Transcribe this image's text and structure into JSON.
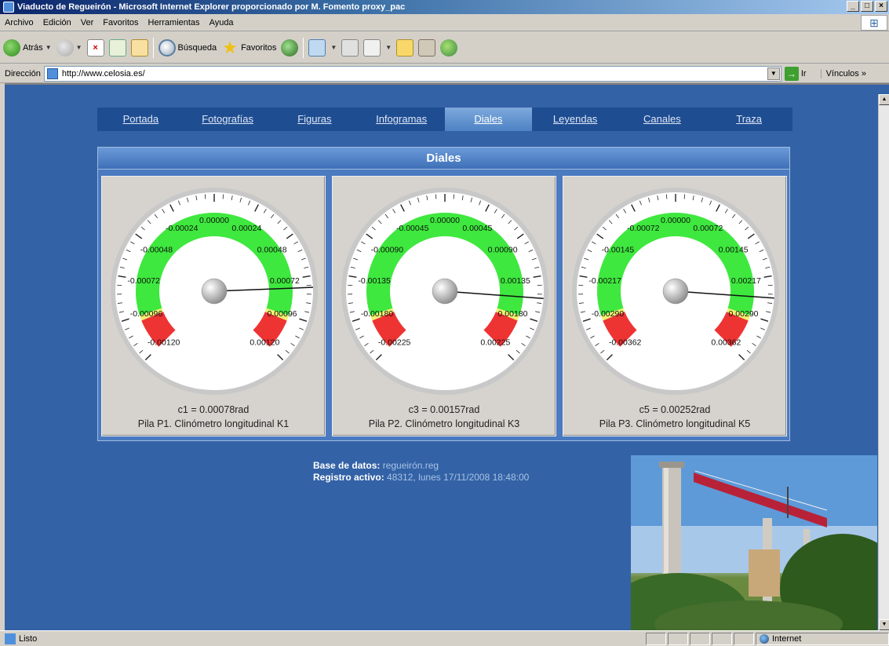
{
  "window": {
    "title": "Viaducto de Regueirón - Microsoft Internet Explorer proporcionado por M. Fomento proxy_pac",
    "buttons": [
      "_",
      "□",
      "×"
    ]
  },
  "menu": [
    "Archivo",
    "Edición",
    "Ver",
    "Favoritos",
    "Herramientas",
    "Ayuda"
  ],
  "toolbar": {
    "back_label": "Atrás",
    "search_label": "Búsqueda",
    "favorites_label": "Favoritos"
  },
  "address": {
    "label": "Dirección",
    "url": "http://www.celosia.es/",
    "go_label": "Ir",
    "links_label": "Vínculos"
  },
  "nav": {
    "items": [
      "Portada",
      "Fotografías",
      "Figuras",
      "Infogramas",
      "Diales",
      "Leyendas",
      "Canales",
      "Traza"
    ],
    "active": "Diales"
  },
  "panel": {
    "title": "Diales"
  },
  "dials": [
    {
      "value_text": "c1 = 0.00078rad",
      "caption": "Pila P1. Clinómetro longitudinal K1",
      "labels": [
        "-0.00120",
        "-0.00096",
        "-0.00072",
        "-0.00048",
        "-0.00024",
        "0.00000",
        "0.00024",
        "0.00048",
        "0.00072",
        "0.00096",
        "0.00120"
      ],
      "min": -0.0012,
      "max": 0.0012,
      "value": 0.00078
    },
    {
      "value_text": "c3 = 0.00157rad",
      "caption": "Pila P2. Clinómetro longitudinal K3",
      "labels": [
        "-0.00225",
        "-0.00180",
        "-0.00135",
        "-0.00090",
        "-0.00045",
        "0.00000",
        "0.00045",
        "0.00090",
        "0.00135",
        "0.00180",
        "0.00225"
      ],
      "min": -0.00225,
      "max": 0.00225,
      "value": 0.00157
    },
    {
      "value_text": "c5 = 0.00252rad",
      "caption": "Pila P3. Clinómetro longitudinal K5",
      "labels": [
        "-0.00362",
        "-0.00290",
        "-0.00217",
        "-0.00145",
        "-0.00072",
        "0.00000",
        "0.00072",
        "0.00145",
        "0.00217",
        "0.00290",
        "0.00362"
      ],
      "min": -0.00362,
      "max": 0.00362,
      "value": 0.00252
    }
  ],
  "db": {
    "base_key": "Base de datos:",
    "base_value": "regueirón.reg",
    "registro_key": "Registro activo:",
    "registro_value": "48312, lunes 17/11/2008 18:48:00"
  },
  "status": {
    "text": "Listo",
    "zone": "Internet"
  },
  "colors": {
    "page_bg": "#3362a6",
    "nav_bg": "#1f4d92",
    "gauge_green": "#3ee83e",
    "gauge_red": "#ee3333",
    "gauge_yellow": "#f0f070"
  }
}
